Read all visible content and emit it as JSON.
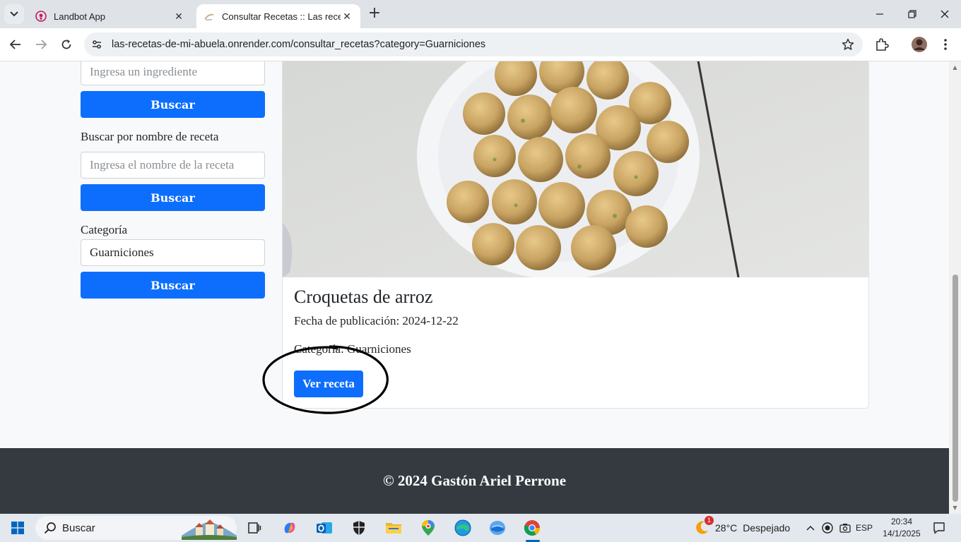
{
  "browser": {
    "tabs": [
      {
        "title": "Landbot App",
        "active": false
      },
      {
        "title": "Consultar Recetas :: Las recetas de mi abuela",
        "active": true
      }
    ],
    "url_host": "las-recetas-de-mi-abuela.onrender.com",
    "url_path": "/consultar_recetas?category=Guarniciones"
  },
  "sidebar": {
    "ingredient_placeholder": "Ingresa un ingrediente",
    "ingredient_button": "Buscar",
    "name_label": "Buscar por nombre de receta",
    "name_placeholder": "Ingresa el nombre de la receta",
    "name_button": "Buscar",
    "category_label": "Categoría",
    "category_value": "Guarniciones",
    "category_button": "Buscar"
  },
  "recipe": {
    "title": "Croquetas de arroz",
    "date_line": "Fecha de publicación: 2024-12-22",
    "category_line": "Categoría: Guarniciones",
    "button": "Ver receta"
  },
  "footer": {
    "text": "© 2024 Gastón Ariel Perrone"
  },
  "taskbar": {
    "search_placeholder": "Buscar",
    "weather_temp": "28°C",
    "weather_desc": "Despejado",
    "weather_badge": "1",
    "language": "ESP",
    "time": "20:34",
    "date": "14/1/2025"
  },
  "colors": {
    "primary": "#0d6efd",
    "footer_bg": "#343a40",
    "page_bg": "#f8f9fa"
  }
}
